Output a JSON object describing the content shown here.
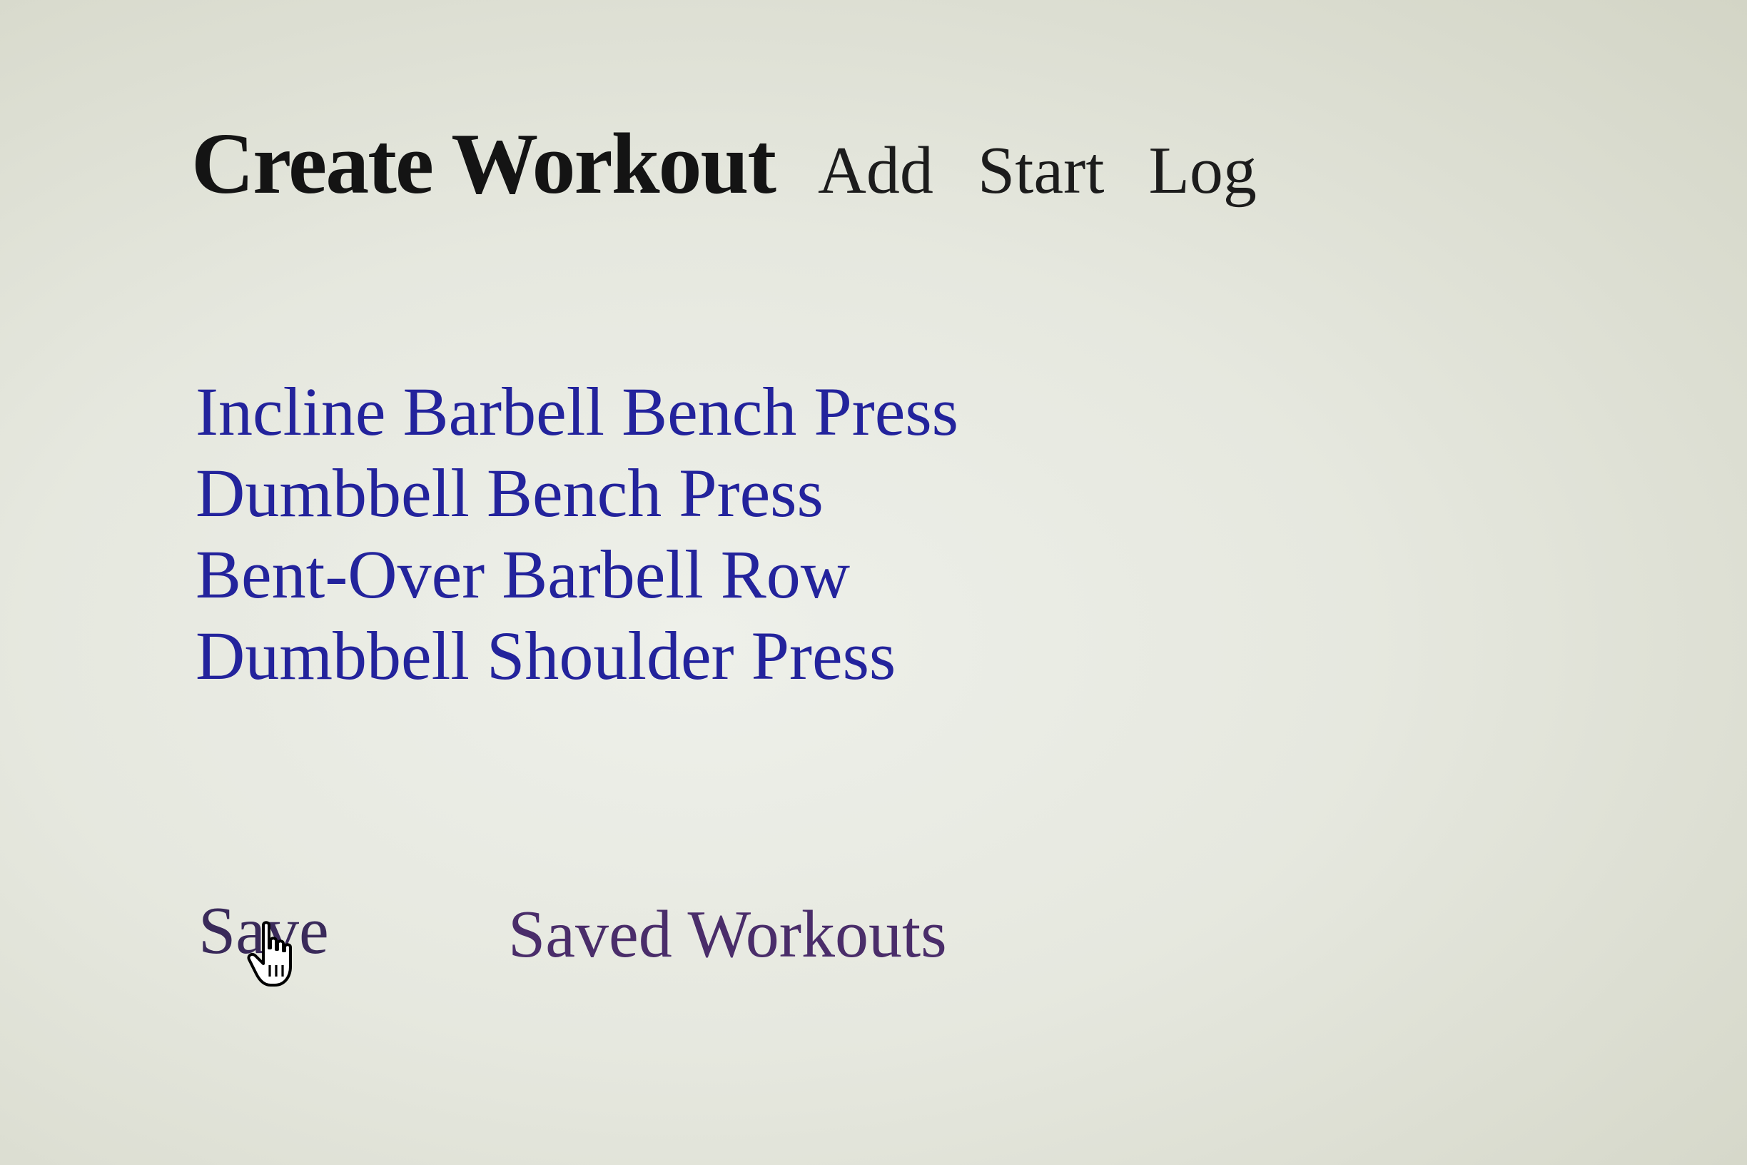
{
  "header": {
    "title": "Create Workout",
    "nav": [
      {
        "label": "Add"
      },
      {
        "label": "Start"
      },
      {
        "label": "Log"
      }
    ]
  },
  "exercises": [
    {
      "label": "Incline Barbell Bench Press"
    },
    {
      "label": "Dumbbell Bench Press"
    },
    {
      "label": "Bent-Over Barbell Row"
    },
    {
      "label": "Dumbbell Shoulder Press"
    }
  ],
  "actions": {
    "save_label": "Save",
    "saved_workouts_label": "Saved Workouts"
  },
  "colors": {
    "link": "#23239c",
    "visited_link": "#4a2d6a",
    "title": "#141414"
  },
  "icons": {
    "cursor": "hand-pointer-icon"
  }
}
